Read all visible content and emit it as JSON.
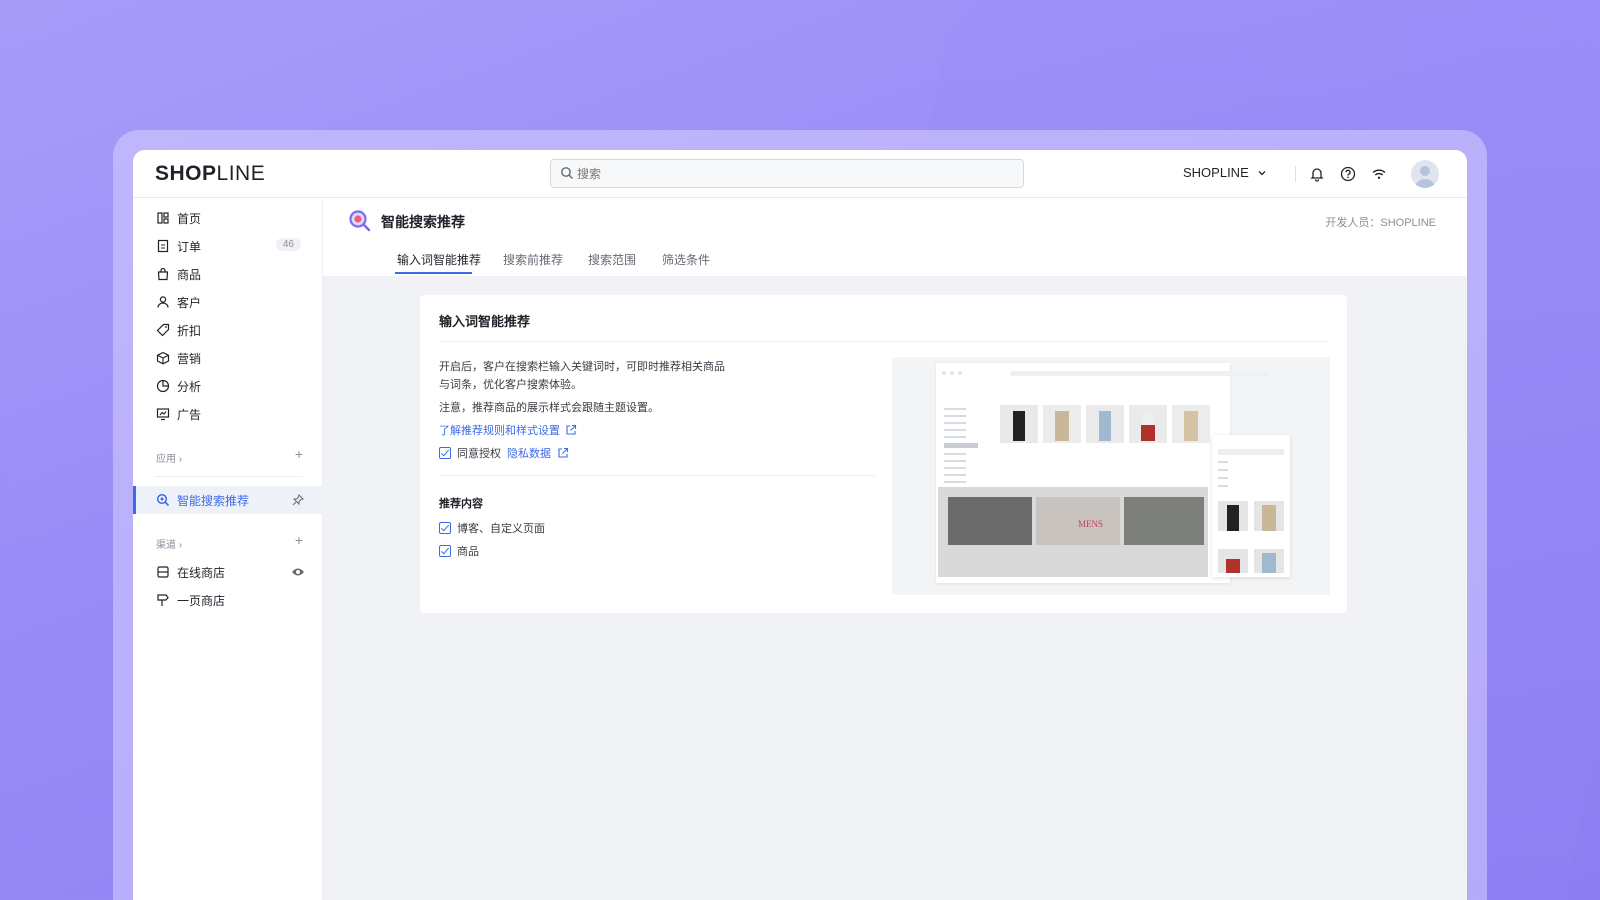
{
  "header": {
    "logo_bold": "SHOP",
    "logo_light": "LINE",
    "search_placeholder": "搜索",
    "store_name": "SHOPLINE"
  },
  "sidebar": {
    "items": [
      {
        "label": "首页",
        "icon": "home-icon"
      },
      {
        "label": "订单",
        "icon": "order-icon",
        "badge": "46"
      },
      {
        "label": "商品",
        "icon": "bag-icon"
      },
      {
        "label": "客户",
        "icon": "user-icon"
      },
      {
        "label": "折扣",
        "icon": "tag-icon"
      },
      {
        "label": "营销",
        "icon": "cube-icon"
      },
      {
        "label": "分析",
        "icon": "pie-icon"
      },
      {
        "label": "广告",
        "icon": "ad-icon"
      }
    ],
    "apps_label": "应用 ›",
    "active_app": "智能搜索推荐",
    "channels_label": "渠道 ›",
    "channels": [
      {
        "label": "在线商店"
      },
      {
        "label": "一页商店"
      }
    ]
  },
  "app": {
    "title": "智能搜索推荐",
    "developer": "开发人员：SHOPLINE",
    "tabs": [
      "输入词智能推荐",
      "搜索前推荐",
      "搜索范围",
      "筛选条件"
    ]
  },
  "card": {
    "title": "输入词智能推荐",
    "description": "开启后，客户在搜索栏输入关键词时，可即时推荐相关商品与词条，优化客户搜索体验。",
    "note": "注意，推荐商品的展示样式会跟随主题设置。",
    "link": "了解推荐规则和样式设置",
    "consent_prefix": "同意授权",
    "consent_link": "隐私数据",
    "section_title": "推荐内容",
    "options": [
      "博客、自定义页面",
      "商品"
    ]
  },
  "colors": {
    "accent": "#3d6be8",
    "background": "#9a8cf7"
  }
}
